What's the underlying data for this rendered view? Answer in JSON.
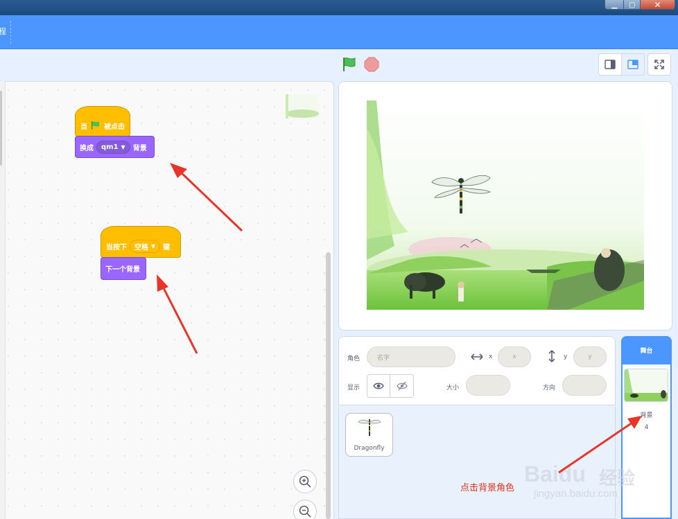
{
  "window": {
    "controls": {
      "minimize": "▁",
      "maximize": "▢",
      "close": "✕"
    }
  },
  "menubar": {
    "fragment": "程"
  },
  "stage_header": {
    "icons": [
      "green-flag-icon",
      "stop-icon",
      "small-stage-icon",
      "normal-stage-icon",
      "fullscreen-icon"
    ]
  },
  "scripts": [
    {
      "hat": {
        "prefix": "当",
        "icon": "green-flag-icon",
        "suffix": "被点击"
      },
      "block": {
        "prefix": "换成",
        "dropdown": "qm1",
        "suffix": "背景"
      }
    },
    {
      "hat": {
        "prefix": "当按下",
        "dropdown": "空格",
        "suffix": "键"
      },
      "block": {
        "label": "下一个背景"
      }
    }
  ],
  "sprite_info": {
    "sprite_label": "角色",
    "name_placeholder": "名字",
    "x_label": "x",
    "x_placeholder": "x",
    "y_label": "y",
    "y_placeholder": "y",
    "show_label": "显示",
    "size_label": "大小",
    "direction_label": "方向"
  },
  "sprites": [
    {
      "name": "Dragonfly"
    }
  ],
  "stage_pane": {
    "header": "舞台",
    "backdrops_label": "背景",
    "backdrops_count": "4"
  },
  "annotation": {
    "text": "点击背景角色"
  },
  "watermark": {
    "logo": "Baidu",
    "cn": "经验",
    "url": "jingyan.baidu.com"
  },
  "colors": {
    "menubar": "#4c97ff",
    "events": "#ffbf00",
    "looks": "#9966ff",
    "annotation_arrow": "#e8352a"
  }
}
